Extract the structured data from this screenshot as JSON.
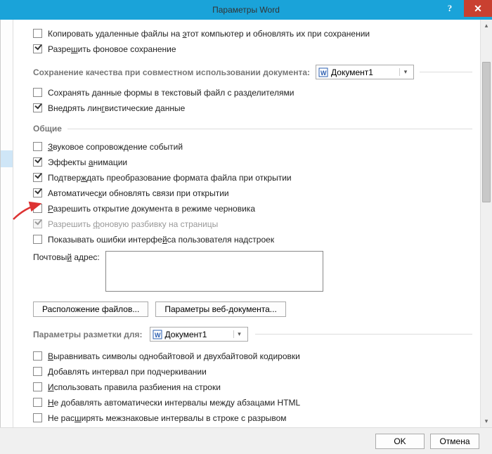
{
  "window": {
    "title": "Параметры Word",
    "help": "?",
    "close": "✕"
  },
  "top_options": [
    {
      "checked": false,
      "label_html": "Копировать удаленные файлы на <span class='u'>э</span>тот компьютер и обновлять их при сохранении"
    },
    {
      "checked": true,
      "label_html": "Разре<span class='u'>ш</span>ить фоновое сохранение"
    }
  ],
  "quality": {
    "title": "Сохранение качества при совместном использовании документа:",
    "selected": "Документ1",
    "options": [
      {
        "checked": false,
        "label_html": "Сохранять данные формы в текстовый файл с разделителями"
      },
      {
        "checked": true,
        "label_html": "Внедрять лин<span class='u'>г</span>вистические данные"
      }
    ]
  },
  "general": {
    "title": "Общие",
    "options": [
      {
        "checked": false,
        "label_html": "<span class='u'>З</span>вуковое сопровождение событий",
        "disabled": false
      },
      {
        "checked": true,
        "label_html": "Эффекты <span class='u'>а</span>нимации",
        "disabled": false
      },
      {
        "checked": true,
        "label_html": "Подтвер<span class='u'>ж</span>дать преобразование формата файла при открытии",
        "disabled": false,
        "highlight": true
      },
      {
        "checked": true,
        "label_html": "Автоматичес<span class='u'>к</span>и обновлять связи при открытии",
        "disabled": false
      },
      {
        "checked": false,
        "label_html": "<span class='u'>Р</span>азрешить открытие документа в режиме черновика",
        "disabled": false
      },
      {
        "checked": true,
        "label_html": "Разрешить <span class='u'>ф</span>оновую разбивку на страницы",
        "disabled": true
      },
      {
        "checked": false,
        "label_html": "Показывать ошибки интерфе<span class='u'>й</span>са пользователя надстроек",
        "disabled": false
      }
    ],
    "mail_label_html": "Почтовы<span class='u'>й</span> адрес:",
    "mail_value": "",
    "file_locations_btn": "Расположение файлов...",
    "web_options_btn": "Параметры веб-документа..."
  },
  "layout": {
    "title_html": "<span class='u'>П</span>араметры разметки для:",
    "selected": "Документ1",
    "options": [
      {
        "checked": false,
        "label_html": "<span class='u'>В</span>ыравнивать символы однобайтовой и двухбайтовой кодировки"
      },
      {
        "checked": false,
        "label_html": "<span class='u'>Д</span>обавлять интервал при подчеркивании"
      },
      {
        "checked": false,
        "label_html": "<span class='u'>И</span>спользовать правила разбиения на строки"
      },
      {
        "checked": false,
        "label_html": "<span class='u'>Н</span>е добавлять автоматически интервалы между абзацами HTML"
      },
      {
        "checked": false,
        "label_html": "Не рас<span class='u'>ш</span>ирять межзнаковые интервалы в строке с разрывом"
      }
    ]
  },
  "footer": {
    "ok": "OK",
    "cancel": "Отмена"
  }
}
